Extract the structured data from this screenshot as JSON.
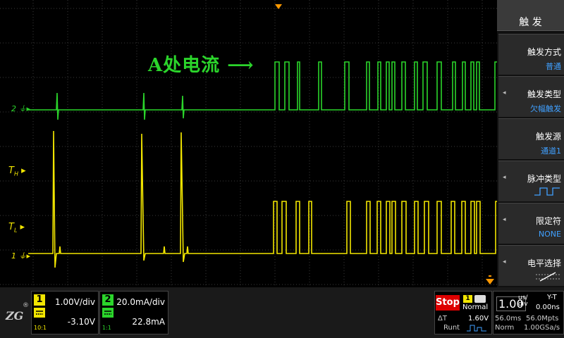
{
  "annotation": {
    "text": "A处电流 ⟶"
  },
  "markers": {
    "ch2_ground": "2",
    "ch1_ground": "1",
    "t_high": "T",
    "t_high_sub": "H",
    "t_low": "T",
    "t_low_sub": "L"
  },
  "trigger_panel": {
    "title": "触 发",
    "items": [
      {
        "label": "触发方式",
        "value": "普通"
      },
      {
        "label": "触发类型",
        "value": "欠幅触发"
      },
      {
        "label": "触发源",
        "value": "通道1"
      },
      {
        "label": "脉冲类型",
        "value": "pulse-icon"
      },
      {
        "label": "限定符",
        "value": "NONE"
      },
      {
        "label": "电平选择",
        "value": "level-icon"
      }
    ]
  },
  "channel1": {
    "number": "1",
    "scale": "1.00V/div",
    "offset": "-3.10V",
    "ratio": "10:1",
    "color": "#f2e600"
  },
  "channel2": {
    "number": "2",
    "scale": "20.0mA/div",
    "offset": "22.8mA",
    "ratio": "1:1",
    "color": "#2bd52b"
  },
  "status": {
    "run_state": "Stop",
    "trig_channel": "1",
    "trig_mode": "Normal",
    "delta_t_label": "ΔT",
    "trig_level": "1.60V",
    "runt_label": "Runt",
    "timebase": "1.00",
    "timebase_unit_top": "us/",
    "timebase_unit_bottom": "div",
    "mode": "Y-T",
    "offset_time": "0.00ns",
    "window": "56.0ms",
    "memory": "56.0Mpts",
    "acq_mode": "Norm",
    "sample_rate": "1.00GSa/s"
  },
  "brand": {
    "logo": "ZLG"
  },
  "colors": {
    "ch1": "#f2e600",
    "ch2": "#2bd52b",
    "stop": "#dd0000",
    "accent": "#40a0ff",
    "trigger_marker": "#ff9900"
  }
}
